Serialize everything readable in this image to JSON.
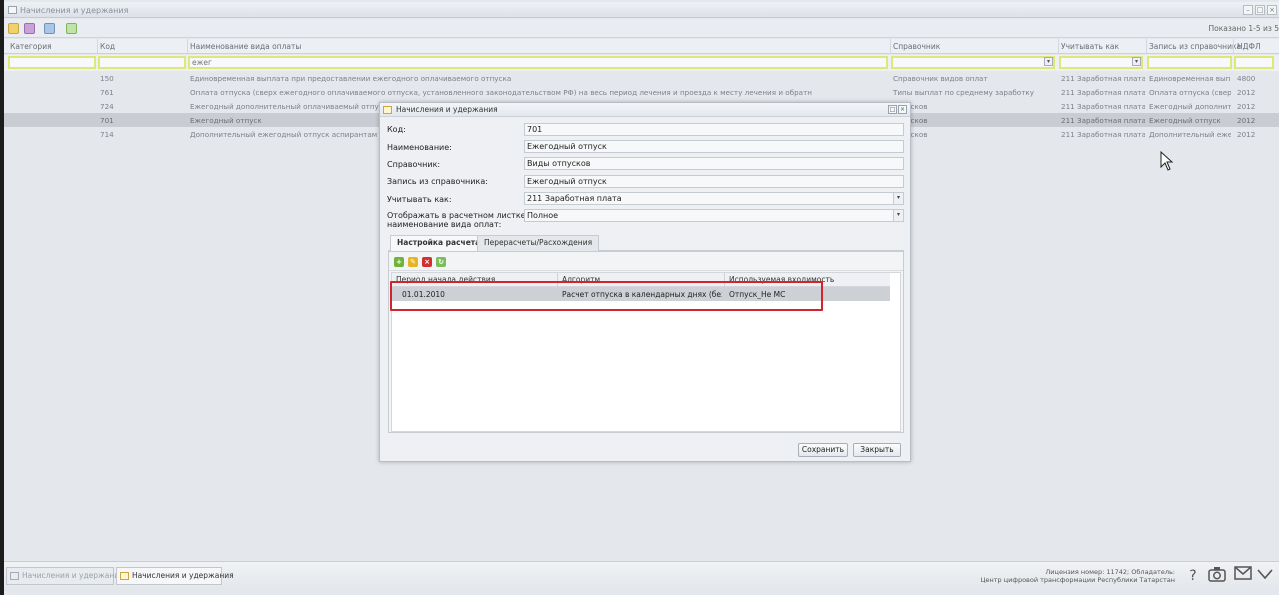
{
  "window": {
    "title": "Начисления и удержания",
    "win_buttons": [
      "–",
      "□",
      "×"
    ]
  },
  "toolbar": {
    "shown_label": "Показано 1-5 из 5"
  },
  "grid": {
    "columns": [
      "Категория",
      "Код",
      "Наименование вида оплаты",
      "Справочник",
      "Учитывать как",
      "Запись из справочника",
      "НДФЛ"
    ],
    "filter_value": "ежег",
    "rows": [
      {
        "code": "150",
        "name": "Единовременная выплата при предоставлении ежегодного оплачиваемого отпуска",
        "ref": "Справочник видов оплат",
        "account": "211 Заработная плата",
        "record": "Единовременная вып...",
        "ndfl": "4800",
        "selected": false
      },
      {
        "code": "761",
        "name": "Оплата отпуска (сверх ежегодного оплачиваемого отпуска, установленного законодательством РФ) на весь период лечения и проезда к месту лечения и обратн",
        "ref": "Типы выплат по среднему заработку",
        "account": "211 Заработная плата",
        "record": "Оплата отпуска (свер...",
        "ndfl": "2012",
        "selected": false
      },
      {
        "code": "724",
        "name": "Ежегодный дополнительный оплачиваемый отпуск за в",
        "ref": "отпусков",
        "account": "211 Заработная плата",
        "record": "Ежегодный дополнит...",
        "ndfl": "2012",
        "selected": false
      },
      {
        "code": "701",
        "name": "Ежегодный отпуск",
        "ref": "отпусков",
        "account": "211 Заработная плата",
        "record": "Ежегодный отпуск",
        "ndfl": "2012",
        "selected": true
      },
      {
        "code": "714",
        "name": "Дополнительный ежегодный отпуск аспирантам",
        "ref": "отпусков",
        "account": "211 Заработная плата",
        "record": "Дополнительный еже...",
        "ndfl": "2012",
        "selected": false
      }
    ]
  },
  "dialog": {
    "title": "Начисления и удержания",
    "fields": {
      "code_label": "Код:",
      "code_value": "701",
      "name_label": "Наименование:",
      "name_value": "Ежегодный отпуск",
      "ref_label": "Справочник:",
      "ref_value": "Виды отпусков",
      "record_label": "Запись из справочника:",
      "record_value": "Ежегодный отпуск",
      "account_label": "Учитывать как:",
      "account_value": "211 Заработная плата",
      "display_label_1": "Отображать в расчетном листке",
      "display_label_2": "наименование вида оплат:",
      "display_value": "Полное"
    },
    "tabs": [
      "Настройка расчета",
      "Перерасчеты/Расхождения"
    ],
    "subgrid": {
      "columns": [
        "Период начала действия",
        "Алгоритм",
        "Используемая входимость"
      ],
      "row": {
        "period": "01.01.2010",
        "algorithm": "Расчет отпуска в календарных днях (без вкл...",
        "usage": "Отпуск_Не МС"
      }
    },
    "buttons": {
      "save": "Сохранить",
      "close": "Закрыть"
    }
  },
  "statusbar": {
    "tasks": [
      "Начисления и удержания",
      "Начисления и удержания"
    ],
    "license_line1": "Лицензия номер: 11742; Обладатель:",
    "license_line2": "Центр цифровой трансформации Республики Татарстан",
    "icons": [
      "help-icon",
      "camera-icon",
      "mail-icon",
      "chevron-down-icon"
    ]
  },
  "colors": {
    "highlight": "#d4242b",
    "filter_border": "#dfe77a",
    "selected_row": "#c9ccd2"
  }
}
